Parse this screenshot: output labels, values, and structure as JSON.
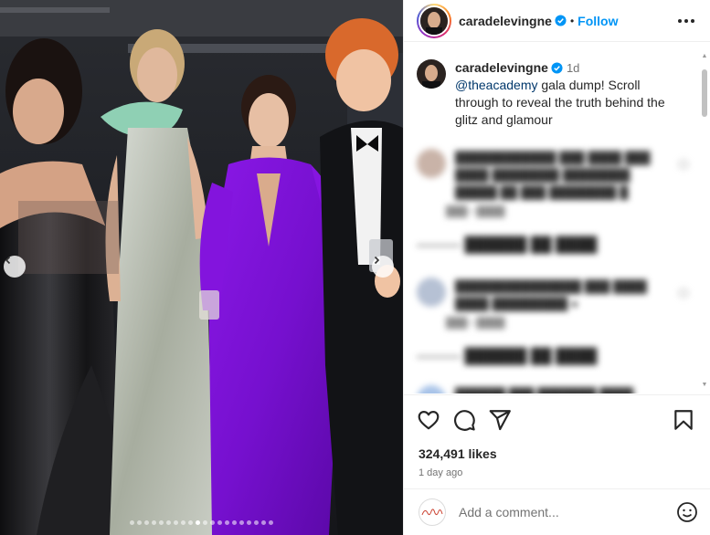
{
  "post": {
    "username": "caradelevingne",
    "follow_label": "Follow",
    "separator": "•",
    "caption": {
      "username": "caradelevingne",
      "time": "1d",
      "mention": "@theacademy",
      "text": " gala dump! Scroll through to reveal the truth behind the glitz and glamour"
    },
    "likes": "324,491 likes",
    "date": "1 day ago",
    "comment_placeholder": "Add a comment..."
  },
  "carousel": {
    "total_slides": 20,
    "active_slide": 10
  },
  "colors": {
    "accent": "#0095f6",
    "verified": "#0095f6",
    "mention": "#00376b",
    "dress_purple": "#7b10d6",
    "dress_sage": "#8fb08a"
  },
  "icons": [
    "more-icon",
    "verified-badge-icon",
    "heart-icon",
    "comment-icon",
    "share-icon",
    "save-icon",
    "emoji-icon",
    "chevron-left-icon",
    "chevron-right-icon"
  ]
}
